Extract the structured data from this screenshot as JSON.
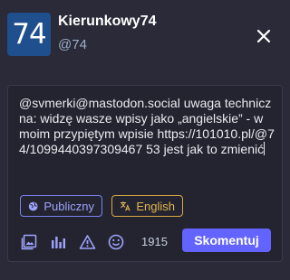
{
  "account": {
    "avatar_text": "74",
    "display_name": "Kierunkowy74",
    "handle": "@74"
  },
  "compose": {
    "text": "@svmerki@mastodon.social uwaga techniczna: widzę wasze wpisy jako „angielskie” - w moim przypiętym wpisie https://101010.pl/@74/1099440397309467 53 jest jak to zmienić"
  },
  "options": {
    "visibility_label": "Publiczny",
    "language_label": "English"
  },
  "toolbar": {
    "icons": [
      "image-icon",
      "poll-icon",
      "warning-icon",
      "emoji-icon"
    ],
    "char_counter": "1915",
    "submit_label": "Skomentuj"
  },
  "colors": {
    "background": "#2a2a38",
    "accent": "#6364ff",
    "visibility_border": "#7d82f0",
    "language_border": "#d8a946",
    "avatar_bg": "#1f4f8c"
  }
}
